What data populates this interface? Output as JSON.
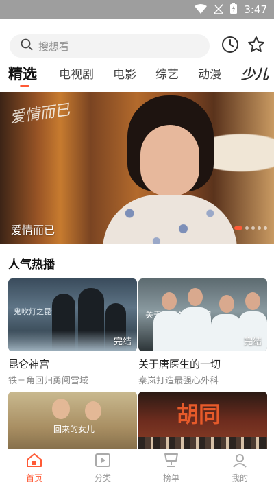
{
  "status_bar": {
    "time": "3:47"
  },
  "search": {
    "placeholder": "搜想看"
  },
  "tabs": [
    {
      "label": "精选",
      "active": true
    },
    {
      "label": "电视剧"
    },
    {
      "label": "电影"
    },
    {
      "label": "综艺"
    },
    {
      "label": "动漫"
    },
    {
      "label": "少儿"
    }
  ],
  "banner": {
    "title": "爱情而已",
    "logo_text": "爱情而已",
    "slide_count": 5,
    "active_slide": 1
  },
  "section": {
    "title": "人气热播",
    "cards": [
      {
        "title": "昆仑神宫",
        "subtitle": "铁三角回归勇闯雪域",
        "badge": "完结",
        "poster_text": "鬼吹灯之昆仑神宫"
      },
      {
        "title": "关于唐医生的一切",
        "subtitle": "秦岚打造最强心外科",
        "badge": "完结",
        "poster_text": "关于唐医生的一切"
      },
      {
        "title": "",
        "subtitle": "",
        "badge": "",
        "poster_text": "回来的女儿"
      },
      {
        "title": "",
        "subtitle": "",
        "badge": "",
        "poster_text": "胡同"
      }
    ]
  },
  "bottom_nav": [
    {
      "label": "首页",
      "icon": "home-icon",
      "active": true
    },
    {
      "label": "分类",
      "icon": "category-icon"
    },
    {
      "label": "榜单",
      "icon": "ranking-icon"
    },
    {
      "label": "我的",
      "icon": "profile-icon"
    }
  ],
  "colors": {
    "accent": "#ff5a36",
    "status_bar": "#9e9e9e"
  }
}
